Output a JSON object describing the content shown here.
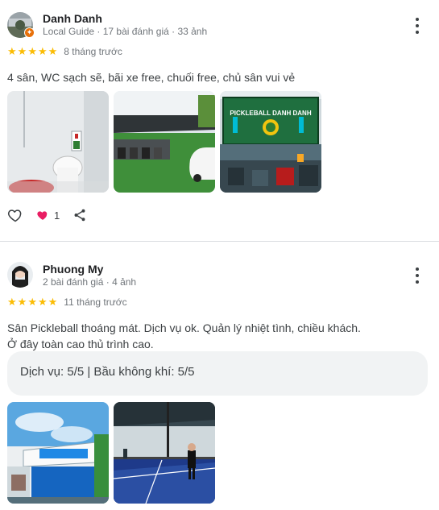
{
  "reviews": [
    {
      "author": "Danh Danh",
      "meta": "Local Guide · 17 bài đánh giá · 33 ảnh",
      "rating": 5,
      "when": "8 tháng trước",
      "text": "4 sân, WC sạch sẽ, bãi xe free, chuối free, chủ sân vui vẻ",
      "likes": "1",
      "photo_sign": "PICKLEBALL DANH DANH"
    },
    {
      "author": "Phuong My",
      "meta": "2 bài đánh giá · 4 ảnh",
      "rating": 5,
      "when": "11 tháng trước",
      "text_line1": "Sân Pickleball thoáng mát. Dịch vụ ok. Quản lý nhiệt tình, chiều khách.",
      "text_line2": "Ở đây toàn cao thủ trình cao.",
      "attributes": "Dịch vụ: 5/5  |  Bầu không khí: 5/5"
    }
  ],
  "icons": {
    "star": "★",
    "heart_outline": "heart-outline-icon",
    "heart_filled": "heart-filled-icon",
    "share": "share-icon",
    "more": "more-vert-icon"
  },
  "colors": {
    "star": "#fbbc04",
    "heart": "#e91e63",
    "guide_badge": "#e8710a"
  }
}
